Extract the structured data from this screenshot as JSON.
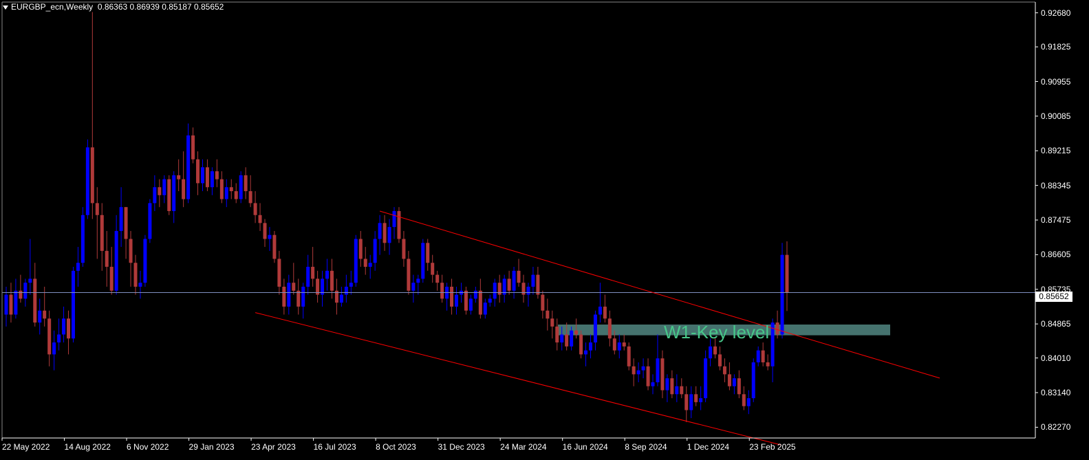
{
  "header": {
    "symbol": "EURGBP_ecn,Weekly",
    "ohlc": "0.86363 0.86939 0.85187 0.85652"
  },
  "current_price_label": "0.85652",
  "zone": {
    "label": "W1-Key level",
    "low": 0.8458,
    "high": 0.8485,
    "fill": "#5f9e98"
  },
  "colors": {
    "background": "#000000",
    "bull": "#0000ff",
    "bear": "#b03a3a",
    "channel": "#ff0000",
    "current_line": "#7f8fc0"
  },
  "chart_data": {
    "type": "candlestick",
    "ylim": [
      0.82,
      0.9295
    ],
    "yticks": [
      "0.92680",
      "0.91825",
      "0.90955",
      "0.90085",
      "0.89215",
      "0.88345",
      "0.87475",
      "0.86605",
      "0.85735",
      "0.84865",
      "0.84010",
      "0.83140",
      "0.82270"
    ],
    "xticks": [
      "22 May 2022",
      "14 Aug 2022",
      "6 Nov 2022",
      "29 Jan 2023",
      "23 Apr 2023",
      "16 Jul 2023",
      "8 Oct 2023",
      "31 Dec 2023",
      "24 Mar 2024",
      "16 Jun 2024",
      "8 Sep 2024",
      "1 Dec 2024",
      "23 Feb 2025"
    ],
    "current_price": 0.85652,
    "channel_upper": [
      [
        "8 Oct 2023",
        0.877
      ],
      [
        "23 Feb 2025",
        0.849
      ]
    ],
    "channel_lower": [
      [
        "23 Apr 2023",
        0.8515
      ],
      [
        "23 Feb 2025",
        0.82
      ]
    ],
    "candles": [
      [
        0.851,
        0.858,
        0.848,
        0.856
      ],
      [
        0.856,
        0.859,
        0.849,
        0.851
      ],
      [
        0.851,
        0.86,
        0.85,
        0.857
      ],
      [
        0.857,
        0.861,
        0.854,
        0.855
      ],
      [
        0.855,
        0.86,
        0.853,
        0.859
      ],
      [
        0.859,
        0.87,
        0.856,
        0.86
      ],
      [
        0.86,
        0.864,
        0.848,
        0.849
      ],
      [
        0.849,
        0.855,
        0.846,
        0.852
      ],
      [
        0.852,
        0.858,
        0.848,
        0.85
      ],
      [
        0.85,
        0.852,
        0.838,
        0.841
      ],
      [
        0.841,
        0.847,
        0.837,
        0.844
      ],
      [
        0.844,
        0.85,
        0.842,
        0.846
      ],
      [
        0.846,
        0.853,
        0.844,
        0.85
      ],
      [
        0.85,
        0.852,
        0.841,
        0.845
      ],
      [
        0.845,
        0.863,
        0.844,
        0.862
      ],
      [
        0.862,
        0.868,
        0.858,
        0.864
      ],
      [
        0.864,
        0.878,
        0.863,
        0.876
      ],
      [
        0.876,
        0.895,
        0.875,
        0.893
      ],
      [
        0.893,
        0.927,
        0.875,
        0.879
      ],
      [
        0.879,
        0.883,
        0.865,
        0.876
      ],
      [
        0.876,
        0.879,
        0.862,
        0.867
      ],
      [
        0.867,
        0.872,
        0.858,
        0.863
      ],
      [
        0.863,
        0.868,
        0.856,
        0.857
      ],
      [
        0.857,
        0.876,
        0.856,
        0.872
      ],
      [
        0.872,
        0.883,
        0.868,
        0.878
      ],
      [
        0.878,
        0.878,
        0.865,
        0.87
      ],
      [
        0.87,
        0.872,
        0.858,
        0.864
      ],
      [
        0.864,
        0.866,
        0.856,
        0.858
      ],
      [
        0.858,
        0.862,
        0.855,
        0.859
      ],
      [
        0.859,
        0.871,
        0.858,
        0.87
      ],
      [
        0.87,
        0.88,
        0.869,
        0.879
      ],
      [
        0.879,
        0.886,
        0.877,
        0.883
      ],
      [
        0.883,
        0.885,
        0.878,
        0.881
      ],
      [
        0.881,
        0.886,
        0.879,
        0.885
      ],
      [
        0.885,
        0.886,
        0.876,
        0.877
      ],
      [
        0.877,
        0.887,
        0.874,
        0.886
      ],
      [
        0.886,
        0.89,
        0.882,
        0.885
      ],
      [
        0.885,
        0.892,
        0.878,
        0.88
      ],
      [
        0.88,
        0.899,
        0.879,
        0.896
      ],
      [
        0.896,
        0.898,
        0.889,
        0.89
      ],
      [
        0.89,
        0.892,
        0.881,
        0.884
      ],
      [
        0.884,
        0.89,
        0.882,
        0.888
      ],
      [
        0.888,
        0.89,
        0.882,
        0.883
      ],
      [
        0.883,
        0.888,
        0.881,
        0.887
      ],
      [
        0.887,
        0.89,
        0.883,
        0.885
      ],
      [
        0.885,
        0.887,
        0.879,
        0.88
      ],
      [
        0.88,
        0.885,
        0.878,
        0.883
      ],
      [
        0.883,
        0.885,
        0.88,
        0.882
      ],
      [
        0.882,
        0.884,
        0.879,
        0.88
      ],
      [
        0.88,
        0.887,
        0.879,
        0.886
      ],
      [
        0.886,
        0.888,
        0.88,
        0.882
      ],
      [
        0.882,
        0.886,
        0.878,
        0.879
      ],
      [
        0.879,
        0.882,
        0.874,
        0.876
      ],
      [
        0.876,
        0.879,
        0.872,
        0.874
      ],
      [
        0.874,
        0.875,
        0.868,
        0.87
      ],
      [
        0.87,
        0.873,
        0.867,
        0.871
      ],
      [
        0.871,
        0.872,
        0.864,
        0.865
      ],
      [
        0.865,
        0.867,
        0.856,
        0.858
      ],
      [
        0.858,
        0.86,
        0.851,
        0.853
      ],
      [
        0.853,
        0.861,
        0.851,
        0.859
      ],
      [
        0.859,
        0.864,
        0.856,
        0.857
      ],
      [
        0.857,
        0.86,
        0.851,
        0.853
      ],
      [
        0.853,
        0.859,
        0.85,
        0.858
      ],
      [
        0.858,
        0.866,
        0.856,
        0.863
      ],
      [
        0.863,
        0.868,
        0.858,
        0.86
      ],
      [
        0.86,
        0.862,
        0.854,
        0.856
      ],
      [
        0.856,
        0.862,
        0.853,
        0.86
      ],
      [
        0.86,
        0.865,
        0.857,
        0.862
      ],
      [
        0.862,
        0.865,
        0.855,
        0.857
      ],
      [
        0.857,
        0.86,
        0.851,
        0.854
      ],
      [
        0.854,
        0.858,
        0.853,
        0.856
      ],
      [
        0.856,
        0.861,
        0.854,
        0.858
      ],
      [
        0.858,
        0.862,
        0.856,
        0.859
      ],
      [
        0.859,
        0.871,
        0.858,
        0.87
      ],
      [
        0.87,
        0.872,
        0.863,
        0.865
      ],
      [
        0.865,
        0.868,
        0.861,
        0.863
      ],
      [
        0.863,
        0.866,
        0.86,
        0.864
      ],
      [
        0.864,
        0.872,
        0.862,
        0.87
      ],
      [
        0.87,
        0.876,
        0.866,
        0.874
      ],
      [
        0.874,
        0.876,
        0.867,
        0.869
      ],
      [
        0.869,
        0.875,
        0.866,
        0.873
      ],
      [
        0.873,
        0.878,
        0.87,
        0.877
      ],
      [
        0.877,
        0.878,
        0.869,
        0.87
      ],
      [
        0.87,
        0.872,
        0.863,
        0.865
      ],
      [
        0.865,
        0.867,
        0.856,
        0.857
      ],
      [
        0.857,
        0.861,
        0.854,
        0.859
      ],
      [
        0.859,
        0.861,
        0.856,
        0.86
      ],
      [
        0.86,
        0.87,
        0.859,
        0.869
      ],
      [
        0.869,
        0.87,
        0.862,
        0.864
      ],
      [
        0.864,
        0.866,
        0.859,
        0.861
      ],
      [
        0.861,
        0.862,
        0.857,
        0.859
      ],
      [
        0.859,
        0.861,
        0.854,
        0.855
      ],
      [
        0.855,
        0.859,
        0.852,
        0.858
      ],
      [
        0.858,
        0.86,
        0.851,
        0.853
      ],
      [
        0.853,
        0.858,
        0.851,
        0.856
      ],
      [
        0.856,
        0.859,
        0.854,
        0.857
      ],
      [
        0.857,
        0.858,
        0.851,
        0.852
      ],
      [
        0.852,
        0.856,
        0.851,
        0.855
      ],
      [
        0.855,
        0.858,
        0.854,
        0.857
      ],
      [
        0.857,
        0.86,
        0.85,
        0.851
      ],
      [
        0.851,
        0.855,
        0.85,
        0.854
      ],
      [
        0.854,
        0.856,
        0.853,
        0.855
      ],
      [
        0.855,
        0.86,
        0.853,
        0.859
      ],
      [
        0.859,
        0.861,
        0.854,
        0.856
      ],
      [
        0.856,
        0.861,
        0.854,
        0.86
      ],
      [
        0.86,
        0.862,
        0.856,
        0.857
      ],
      [
        0.857,
        0.863,
        0.855,
        0.862
      ],
      [
        0.862,
        0.865,
        0.858,
        0.859
      ],
      [
        0.859,
        0.861,
        0.854,
        0.856
      ],
      [
        0.856,
        0.859,
        0.853,
        0.858
      ],
      [
        0.858,
        0.863,
        0.856,
        0.861
      ],
      [
        0.861,
        0.863,
        0.855,
        0.856
      ],
      [
        0.856,
        0.857,
        0.85,
        0.852
      ],
      [
        0.852,
        0.855,
        0.847,
        0.85
      ],
      [
        0.85,
        0.852,
        0.845,
        0.848
      ],
      [
        0.848,
        0.85,
        0.842,
        0.844
      ],
      [
        0.844,
        0.848,
        0.842,
        0.846
      ],
      [
        0.846,
        0.849,
        0.842,
        0.843
      ],
      [
        0.843,
        0.848,
        0.842,
        0.847
      ],
      [
        0.847,
        0.85,
        0.845,
        0.846
      ],
      [
        0.846,
        0.847,
        0.84,
        0.841
      ],
      [
        0.841,
        0.844,
        0.838,
        0.842
      ],
      [
        0.842,
        0.846,
        0.84,
        0.844
      ],
      [
        0.844,
        0.852,
        0.842,
        0.851
      ],
      [
        0.851,
        0.859,
        0.849,
        0.853
      ],
      [
        0.853,
        0.856,
        0.849,
        0.85
      ],
      [
        0.85,
        0.852,
        0.843,
        0.845
      ],
      [
        0.845,
        0.847,
        0.841,
        0.842
      ],
      [
        0.842,
        0.846,
        0.84,
        0.844
      ],
      [
        0.844,
        0.846,
        0.842,
        0.843
      ],
      [
        0.843,
        0.844,
        0.837,
        0.838
      ],
      [
        0.838,
        0.84,
        0.833,
        0.836
      ],
      [
        0.836,
        0.839,
        0.834,
        0.837
      ],
      [
        0.837,
        0.84,
        0.835,
        0.838
      ],
      [
        0.838,
        0.84,
        0.832,
        0.833
      ],
      [
        0.833,
        0.836,
        0.831,
        0.834
      ],
      [
        0.834,
        0.846,
        0.833,
        0.84
      ],
      [
        0.84,
        0.842,
        0.83,
        0.832
      ],
      [
        0.832,
        0.836,
        0.829,
        0.835
      ],
      [
        0.835,
        0.837,
        0.83,
        0.831
      ],
      [
        0.831,
        0.836,
        0.829,
        0.833
      ],
      [
        0.833,
        0.835,
        0.83,
        0.831
      ],
      [
        0.831,
        0.833,
        0.824,
        0.827
      ],
      [
        0.827,
        0.833,
        0.825,
        0.831
      ],
      [
        0.831,
        0.833,
        0.828,
        0.829
      ],
      [
        0.829,
        0.833,
        0.827,
        0.83
      ],
      [
        0.83,
        0.842,
        0.829,
        0.84
      ],
      [
        0.84,
        0.845,
        0.838,
        0.843
      ],
      [
        0.843,
        0.845,
        0.84,
        0.841
      ],
      [
        0.841,
        0.843,
        0.837,
        0.838
      ],
      [
        0.838,
        0.84,
        0.834,
        0.836
      ],
      [
        0.836,
        0.839,
        0.832,
        0.833
      ],
      [
        0.833,
        0.836,
        0.831,
        0.835
      ],
      [
        0.835,
        0.837,
        0.83,
        0.831
      ],
      [
        0.831,
        0.833,
        0.827,
        0.828
      ],
      [
        0.828,
        0.832,
        0.826,
        0.83
      ],
      [
        0.83,
        0.84,
        0.829,
        0.839
      ],
      [
        0.839,
        0.843,
        0.838,
        0.842
      ],
      [
        0.842,
        0.844,
        0.838,
        0.839
      ],
      [
        0.839,
        0.841,
        0.837,
        0.838
      ],
      [
        0.838,
        0.85,
        0.834,
        0.849
      ],
      [
        0.849,
        0.852,
        0.845,
        0.846
      ],
      [
        0.846,
        0.869,
        0.845,
        0.866
      ],
      [
        0.866,
        0.8694,
        0.8519,
        0.8565
      ]
    ]
  }
}
